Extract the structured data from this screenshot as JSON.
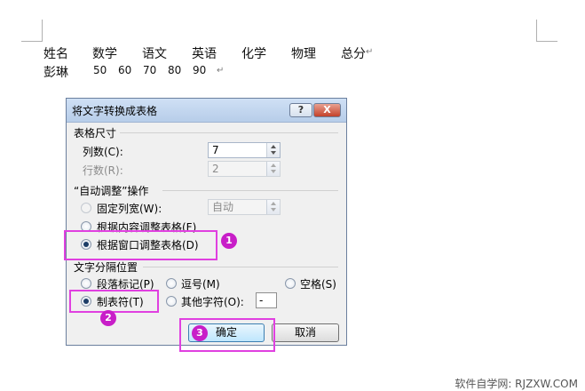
{
  "document": {
    "headers": [
      "姓名",
      "数学",
      "语文",
      "英语",
      "化学",
      "物理",
      "总分"
    ],
    "row": {
      "name": "彭琳",
      "scores": [
        "50",
        "60",
        "70",
        "80",
        "90"
      ]
    },
    "paragraph_mark": "↵"
  },
  "dialog": {
    "title": "将文字转换成表格",
    "help_label": "?",
    "close_label": "X",
    "size_section": {
      "title": "表格尺寸",
      "columns_label": "列数(C):",
      "columns_value": "7",
      "rows_label": "行数(R):",
      "rows_value": "2"
    },
    "autofit_section": {
      "title": "“自动调整”操作",
      "fixed_width_label": "固定列宽(W):",
      "fixed_width_value": "自动",
      "content_label": "根据内容调整表格(F)",
      "window_label": "根据窗口调整表格(D)",
      "selected": "window"
    },
    "separator_section": {
      "title": "文字分隔位置",
      "paragraph_label": "段落标记(P)",
      "comma_label": "逗号(M)",
      "space_label": "空格(S)",
      "tab_label": "制表符(T)",
      "other_label": "其他字符(O):",
      "other_value": "-",
      "selected": "tab"
    },
    "ok_label": "确定",
    "cancel_label": "取消"
  },
  "annotations": {
    "badge_1": "1",
    "badge_2": "2",
    "badge_3": "3",
    "highlight_color": "#e040e0",
    "badge_color": "#c81ec8"
  },
  "watermark": "软件自学网: RJZXW.COM"
}
